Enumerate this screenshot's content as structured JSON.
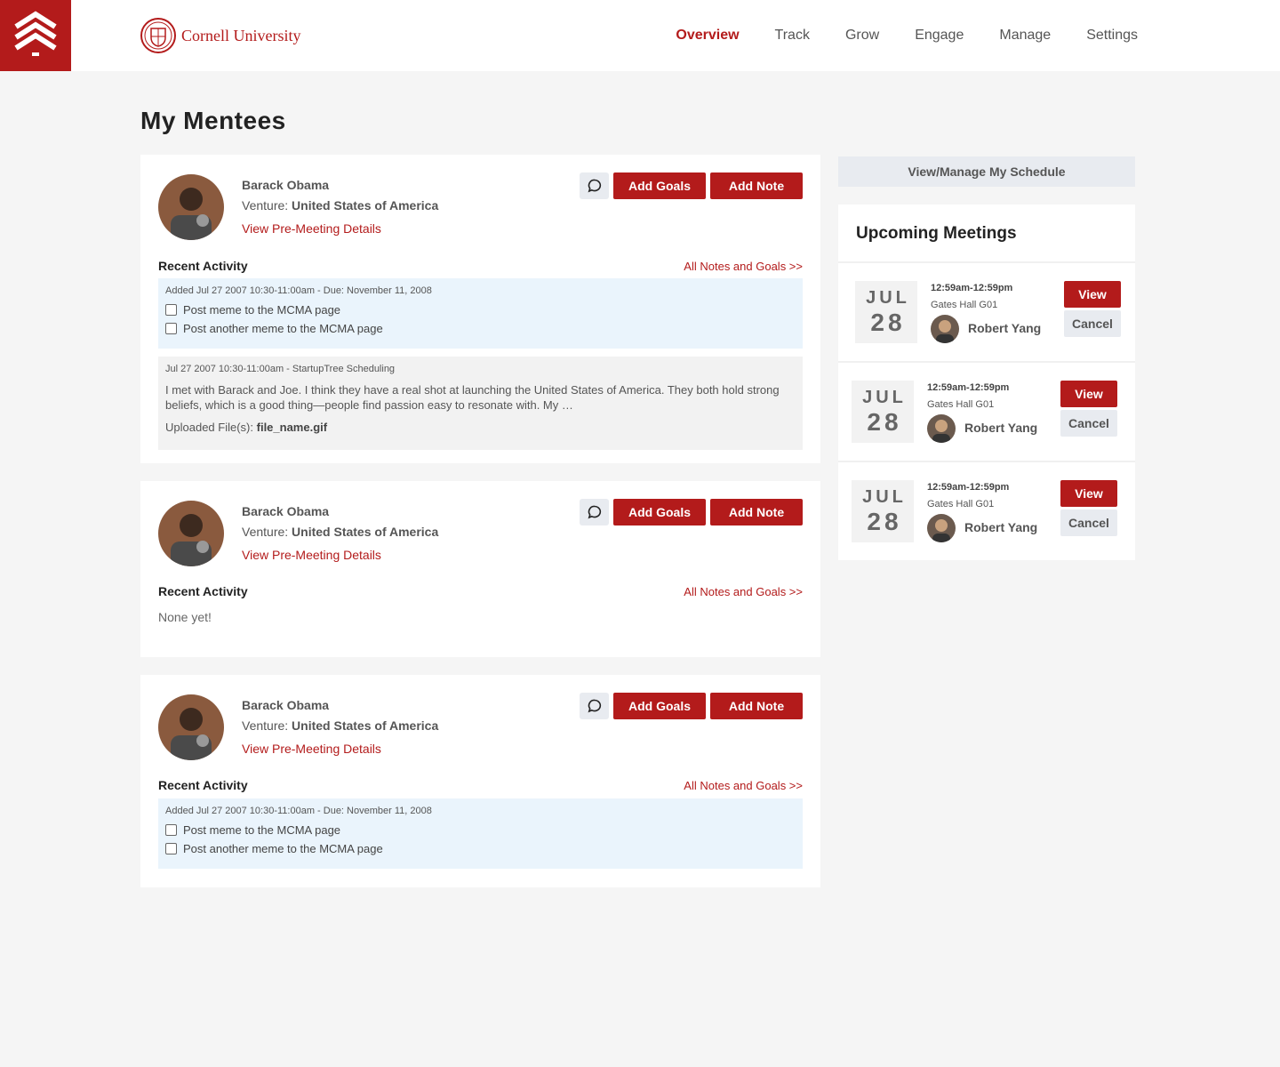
{
  "nav": {
    "brand": "Cornell University",
    "items": [
      "Overview",
      "Track",
      "Grow",
      "Engage",
      "Manage",
      "Settings"
    ],
    "active": "Overview"
  },
  "page": {
    "title": "My Mentees"
  },
  "colors": {
    "accent": "#b31b1b",
    "goal_bg": "#eaf4fc",
    "note_bg": "#f2f2f2",
    "page_bg": "#f5f5f5"
  },
  "icons": {
    "logo": "chevrons-up-logo-icon",
    "chat": "chat-bubble-icon",
    "seal": "cornell-seal-icon"
  },
  "mentees": [
    {
      "name": "Barack Obama",
      "venture_label": "Venture:",
      "venture": "United States of America",
      "details_link": "View Pre-Meeting Details",
      "add_goals": "Add Goals",
      "add_note": "Add Note",
      "recent_label": "Recent Activity",
      "all_link": "All Notes and Goals >>",
      "goals": {
        "meta": "Added Jul 27 2007 10:30-11:00am - Due: November 11, 2008",
        "items": [
          "Post meme to the MCMA page",
          "Post another meme to the MCMA page"
        ]
      },
      "note": {
        "meta": "Jul 27 2007 10:30-11:00am - StartupTree Scheduling",
        "text": "I met with Barack and Joe.  I think they have a real shot at launching the United States of America. They both hold strong beliefs, which is a good thing—people find passion easy to resonate with. My …",
        "files_label": "Uploaded File(s):",
        "file": "file_name.gif"
      }
    },
    {
      "name": "Barack Obama",
      "venture_label": "Venture:",
      "venture": "United States of America",
      "details_link": "View Pre-Meeting Details",
      "add_goals": "Add Goals",
      "add_note": "Add Note",
      "recent_label": "Recent Activity",
      "all_link": "All Notes and Goals >>",
      "empty": "None yet!"
    },
    {
      "name": "Barack Obama",
      "venture_label": "Venture:",
      "venture": "United States of America",
      "details_link": "View Pre-Meeting Details",
      "add_goals": "Add Goals",
      "add_note": "Add Note",
      "recent_label": "Recent Activity",
      "all_link": "All Notes and Goals >>",
      "goals": {
        "meta": "Added Jul 27 2007 10:30-11:00am - Due: November 11, 2008",
        "items": [
          "Post meme to the MCMA page",
          "Post another meme to the MCMA page"
        ]
      }
    }
  ],
  "sidebar": {
    "schedule_button": "View/Manage My Schedule",
    "meetings_title": "Upcoming Meetings",
    "meetings": [
      {
        "month": "JUL",
        "day": "28",
        "time": "12:59am-12:59pm",
        "location": "Gates Hall G01",
        "person": "Robert Yang",
        "view": "View",
        "cancel": "Cancel"
      },
      {
        "month": "JUL",
        "day": "28",
        "time": "12:59am-12:59pm",
        "location": "Gates Hall G01",
        "person": "Robert Yang",
        "view": "View",
        "cancel": "Cancel"
      },
      {
        "month": "JUL",
        "day": "28",
        "time": "12:59am-12:59pm",
        "location": "Gates Hall G01",
        "person": "Robert Yang",
        "view": "View",
        "cancel": "Cancel"
      }
    ]
  }
}
